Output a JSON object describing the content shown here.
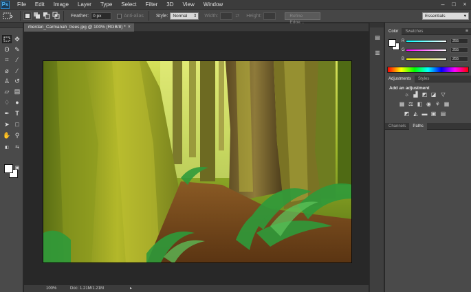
{
  "app": {
    "logo": "Ps"
  },
  "menu": {
    "items": [
      "File",
      "Edit",
      "Image",
      "Layer",
      "Type",
      "Select",
      "Filter",
      "3D",
      "View",
      "Window"
    ]
  },
  "window_controls": {
    "minimize": "–",
    "maximize": "□",
    "close": "×"
  },
  "options_bar": {
    "feather_label": "Feather:",
    "feather_value": "0 px",
    "anti_alias_label": "Anti-alias",
    "style_label": "Style:",
    "style_value": "Normal",
    "width_label": "Width:",
    "height_label": "Height:",
    "refine_edge_label": "Refine Edge..."
  },
  "workspace": {
    "value": "Essentials"
  },
  "document": {
    "tab_title": "rberdan_Carmanah_trees.jpg @ 100% (RGB/8) *",
    "zoom": "100%",
    "doc_info": "Doc: 1.21M/1.21M"
  },
  "color_panel": {
    "tabs": [
      "Color",
      "Swatches"
    ],
    "channels": [
      {
        "label": "R",
        "value": "255"
      },
      {
        "label": "G",
        "value": "255"
      },
      {
        "label": "B",
        "value": "255"
      }
    ]
  },
  "adjustments_panel": {
    "tabs": [
      "Adjustments",
      "Styles"
    ],
    "title": "Add an adjustment"
  },
  "layers_panel": {
    "tabs": [
      "Channels",
      "Paths"
    ]
  },
  "colors": {
    "menubar": "#3c3c3c",
    "panel": "#4a4a4a",
    "canvas_bg": "#282828"
  }
}
